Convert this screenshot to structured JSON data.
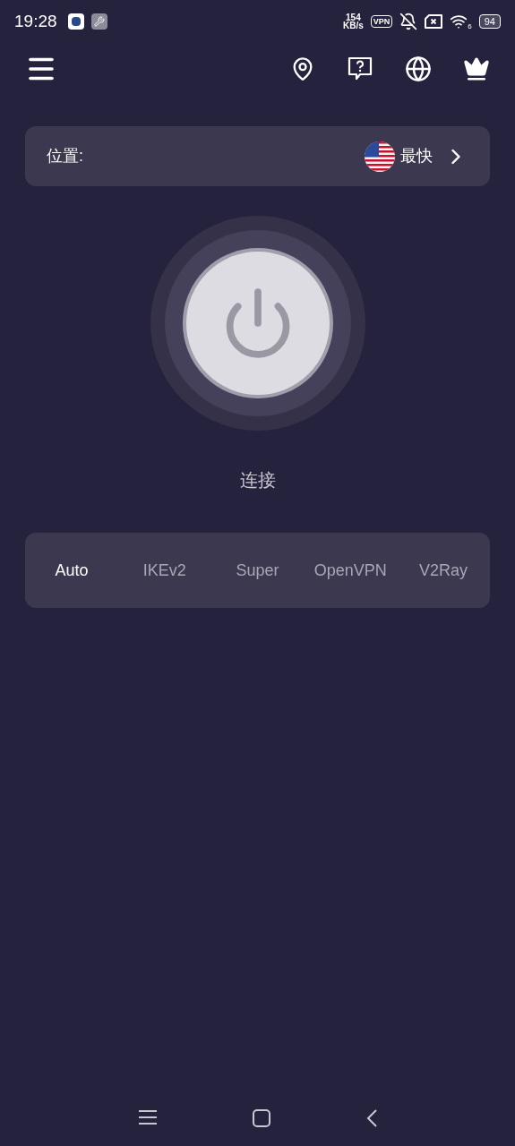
{
  "status_bar": {
    "time": "19:28",
    "speed_value": "154",
    "speed_unit": "KB/s",
    "vpn_badge": "VPN",
    "wifi_band": "6",
    "battery": "94"
  },
  "location": {
    "label": "位置:",
    "server": "最快"
  },
  "power": {
    "label": "连接"
  },
  "protocols": [
    {
      "label": "Auto",
      "selected": true
    },
    {
      "label": "IKEv2",
      "selected": false
    },
    {
      "label": "Super",
      "selected": false
    },
    {
      "label": "OpenVPN",
      "selected": false
    },
    {
      "label": "V2Ray",
      "selected": false
    }
  ]
}
